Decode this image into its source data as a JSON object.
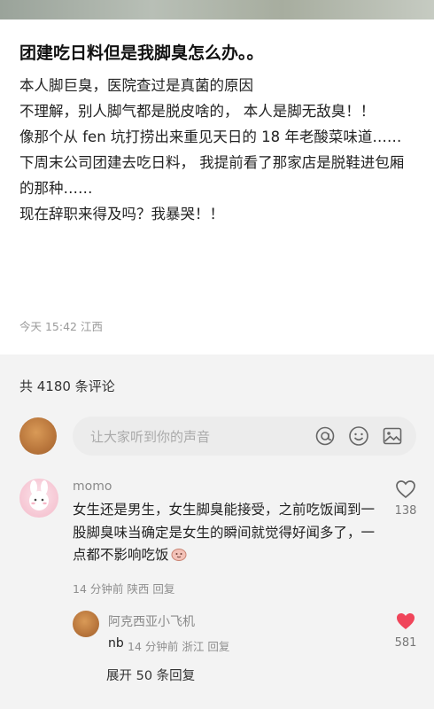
{
  "post": {
    "title": "团建吃日料但是我脚臭怎么办。。",
    "lines": [
      "本人脚巨臭，医院查过是真菌的原因",
      "不理解，别人脚气都是脱皮啥的， 本人是脚无敌臭！！",
      "像那个从 fen 坑打捞出来重见天日的 18 年老酸菜味道……",
      "下周末公司团建去吃日料， 我提前看了那家店是脱鞋进包厢的那种……",
      "现在辞职来得及吗？我暴哭！！"
    ],
    "meta": "今天 15:42 江西"
  },
  "comments_header": "共 4180 条评论",
  "input": {
    "placeholder": "让大家听到你的声音",
    "icons": [
      "at-icon",
      "emoji-icon",
      "image-icon"
    ]
  },
  "comments": [
    {
      "username": "momo",
      "text": "女生还是男生，女生脚臭能接受，之前吃饭闻到一股脚臭味当确定是女生的瞬间就觉得好闻多了，一点都不影响吃饭",
      "meta": "14 分钟前 陕西 回复",
      "likes": "138",
      "liked": false
    },
    {
      "username": "阿克西亚小飞机",
      "text": "nb",
      "meta": "14 分钟前 浙江 回复",
      "likes": "581",
      "liked": true
    }
  ],
  "expand_label": "展开 50 条回复",
  "colors": {
    "liked": "#f0455a",
    "muted": "#8e8e8e"
  }
}
